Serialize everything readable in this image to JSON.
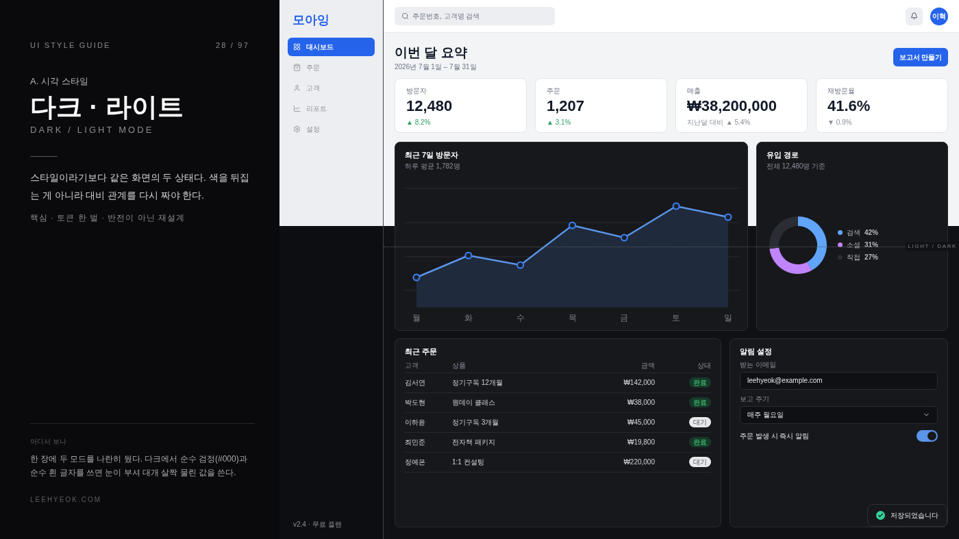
{
  "guide": {
    "eyebrow": "UI STYLE GUIDE",
    "page": "28 / 97",
    "section": "A. 시각 스타일",
    "title": "다크 · 라이트",
    "subtitle": "DARK / LIGHT MODE",
    "body": "스타일이라기보다 같은 화면의 두 상태다. 색을 뒤집는 게 아니라 대비 관계를 다시 짜야 한다.",
    "keywords": "핵심 · 토큰 한 벌 · 반전이 아닌 재설계",
    "note_label": "어디서 보나",
    "note": "한 장에 두 모드를 나란히 뒀다. 다크에서 순수 검정(#000)과 순수 흰 글자를 쓰면 눈이 부셔 대개 살짝 물린 값을 쓴다.",
    "site": "LEEHYEOK.COM"
  },
  "app": {
    "logo": "모아잉",
    "nav": [
      {
        "label": "대시보드",
        "selected": true
      },
      {
        "label": "주문",
        "selected": false
      },
      {
        "label": "고객",
        "selected": false
      },
      {
        "label": "리포트",
        "selected": false
      },
      {
        "label": "설정",
        "selected": false
      }
    ],
    "version": "v2.4 · 무료 플랜",
    "search": {
      "placeholder": "주문번호, 고객명 검색"
    },
    "avatar": "이혁",
    "heading": "이번 달 요약",
    "period": "2026년 7월 1일 – 7월 31일",
    "report_button": "보고서 만들기",
    "kpis": [
      {
        "label": "방문자",
        "value": "12,480",
        "delta": "▲ 8.2%",
        "positive": true
      },
      {
        "label": "주문",
        "value": "1,207",
        "delta": "▲ 3.1%",
        "positive": true
      },
      {
        "label": "매출",
        "value": "₩38,200,000",
        "note": "지난달 대비",
        "delta": "▲ 5.4%",
        "positive": false
      },
      {
        "label": "재방문율",
        "value": "41.6%",
        "delta": "▼ 0.9%",
        "positive": false
      }
    ],
    "visitors": {
      "title": "최근 7일 방문자",
      "subtitle": "하루 평균 1,782명",
      "days": [
        "월",
        "화",
        "수",
        "목",
        "금",
        "토",
        "일"
      ]
    },
    "sources": {
      "title": "유입 경로",
      "subtitle": "전체 12,480명 기준",
      "legend": [
        {
          "value": "42%",
          "color": "#60a5fa"
        },
        {
          "value": "31%",
          "color": "#c084fc"
        },
        {
          "value": "27%",
          "color": "#2a2d33"
        }
      ],
      "chart_data": {
        "type": "donut",
        "categories": [
          "검색",
          "소셜",
          "직접"
        ],
        "values": [
          42,
          31,
          27
        ]
      }
    },
    "orders": {
      "title": "최근 주문",
      "columns": [
        "고객",
        "상품",
        "금액",
        "상태"
      ],
      "rows": [
        {
          "customer": "김서연",
          "product": "정기구독 12개월",
          "amount": "₩142,000",
          "status": "완료",
          "kind": "done"
        },
        {
          "customer": "박도현",
          "product": "원데이 클래스",
          "amount": "₩38,000",
          "status": "완료",
          "kind": "done"
        },
        {
          "customer": "이하윤",
          "product": "정기구독 3개월",
          "amount": "₩45,000",
          "status": "대기",
          "kind": "waiting"
        },
        {
          "customer": "최민준",
          "product": "전자책 패키지",
          "amount": "₩19,800",
          "status": "완료",
          "kind": "done"
        },
        {
          "customer": "정예은",
          "product": "1:1 컨설팅",
          "amount": "₩220,000",
          "status": "대기",
          "kind": "waiting"
        }
      ]
    },
    "settings": {
      "title": "알림 설정",
      "email_label": "받는 이메일",
      "email": "leehyeok@example.com",
      "period_label": "보고 주기",
      "period_value": "매주 월요일",
      "toggle_label": "주문 발생 시 즉시 알림",
      "toggle_on": true
    },
    "toast": "저장되었습니다",
    "split_label": "LIGHT / DARK"
  }
}
